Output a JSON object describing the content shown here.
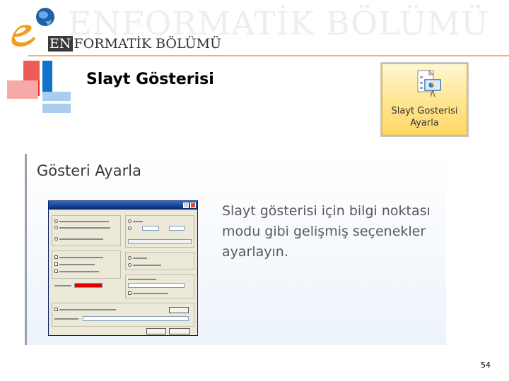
{
  "header": {
    "watermark": "ENFORMATİK BÖLÜMÜ",
    "brand_prefix": "EN",
    "brand_rest": "FORMATİK BÖLÜMÜ"
  },
  "slide": {
    "title": "Slayt Gösterisi",
    "page_number": "54"
  },
  "ribbon_button": {
    "line1": "Slayt Gosterisi",
    "line2": "Ayarla"
  },
  "panel": {
    "title": "Gösteri Ayarla",
    "description": "Slayt gösterisi için bilgi noktası modu gibi gelişmiş seçenekler ayarlayın."
  },
  "colors": {
    "accent_orange": "#f39c1f",
    "logo_blue": "#1f5fa8",
    "deco_red": "#e8312f",
    "deco_blue": "#0e74c9",
    "pen_color": "#e00000"
  }
}
